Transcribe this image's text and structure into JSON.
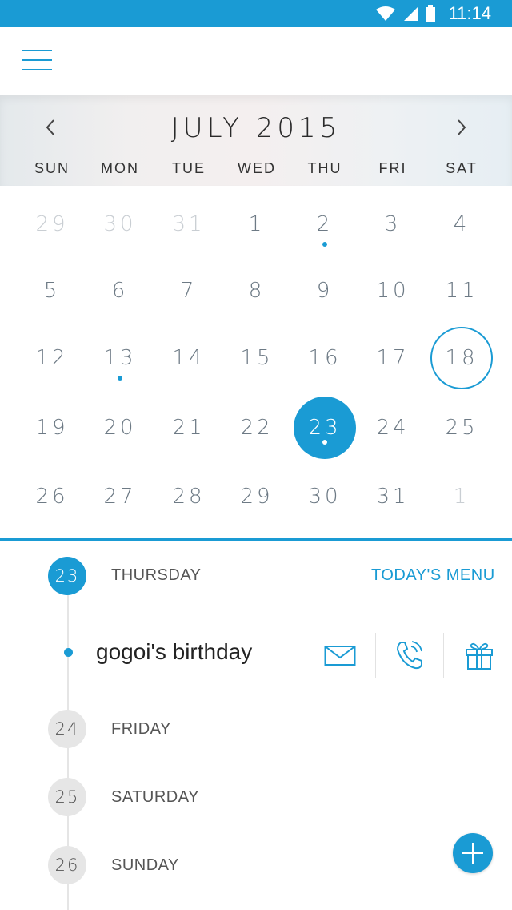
{
  "status": {
    "time": "11:14"
  },
  "calendar": {
    "month_title": "JULY 2015",
    "weekdays": [
      "SUN",
      "MON",
      "TUE",
      "WED",
      "THU",
      "FRI",
      "SAT"
    ],
    "rows": [
      [
        "29",
        "30",
        "31",
        "1",
        "2",
        "3",
        "4"
      ],
      [
        "5",
        "6",
        "7",
        "8",
        "9",
        "10",
        "11"
      ],
      [
        "12",
        "13",
        "14",
        "15",
        "16",
        "17",
        "18"
      ],
      [
        "19",
        "20",
        "21",
        "22",
        "23",
        "24",
        "25"
      ],
      [
        "26",
        "27",
        "28",
        "29",
        "30",
        "31",
        "1"
      ]
    ],
    "muted_cells": [
      [
        0,
        0
      ],
      [
        0,
        1
      ],
      [
        0,
        2
      ],
      [
        4,
        6
      ]
    ],
    "event_dots": [
      [
        0,
        4
      ],
      [
        2,
        1
      ],
      [
        3,
        4
      ]
    ],
    "today_ring": [
      2,
      6
    ],
    "selected": [
      3,
      4
    ]
  },
  "agenda": {
    "todays_menu": "TODAY'S MENU",
    "days": [
      {
        "num": "23",
        "label": "THURSDAY"
      },
      {
        "num": "24",
        "label": "FRIDAY"
      },
      {
        "num": "25",
        "label": "SATURDAY"
      },
      {
        "num": "26",
        "label": "SUNDAY"
      }
    ],
    "event": {
      "title": "gogoi's birthday",
      "actions": [
        "mail-icon",
        "phone-icon",
        "gift-icon"
      ]
    }
  },
  "colors": {
    "accent": "#1a9bd4",
    "muted": "#c9ced3",
    "day_text": "#6d7a85"
  }
}
